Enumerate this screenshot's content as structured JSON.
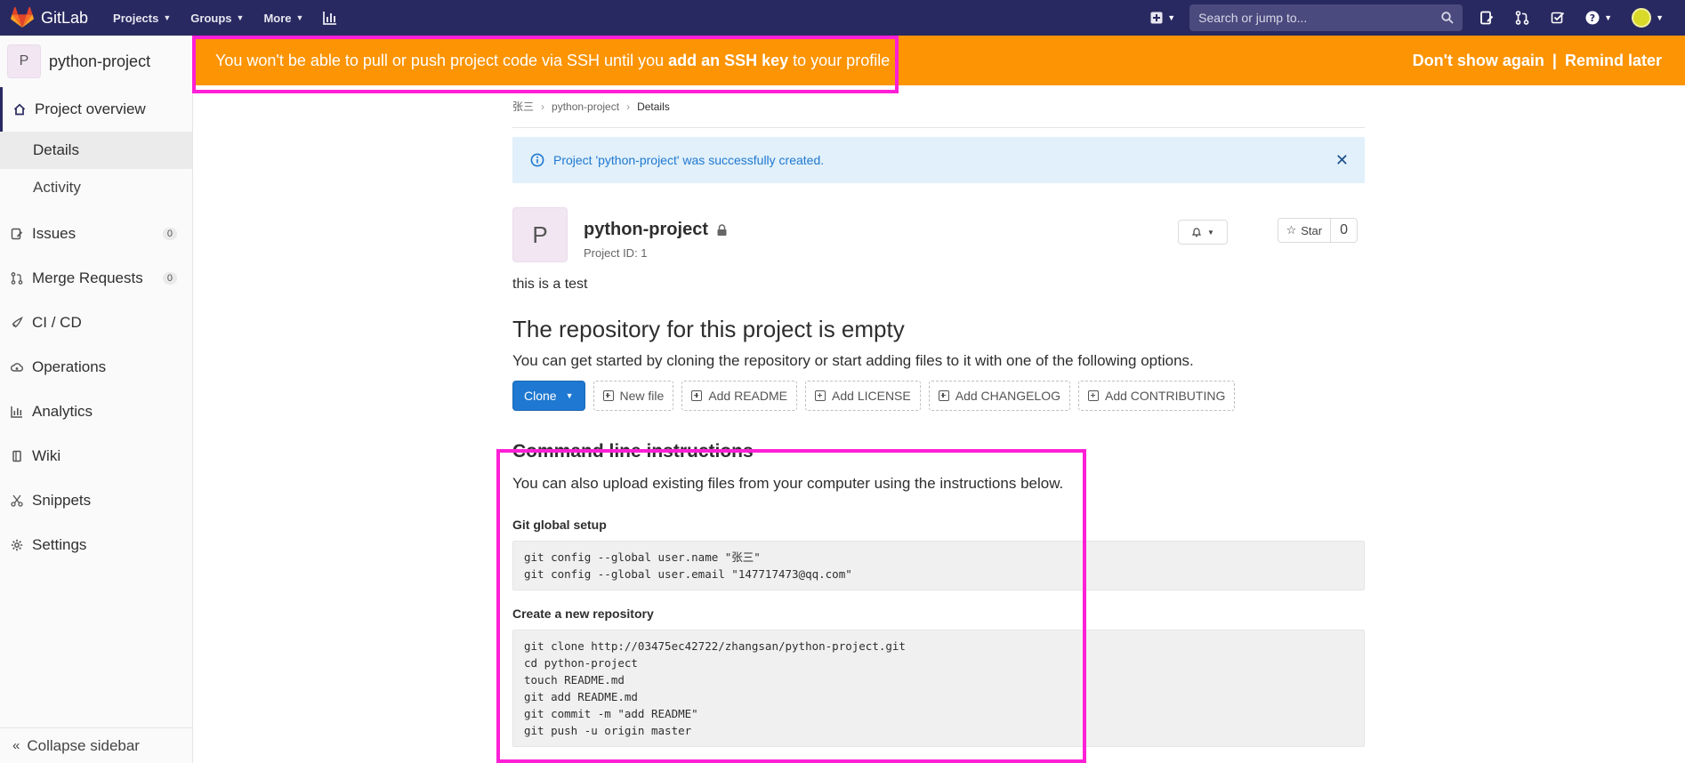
{
  "navbar": {
    "brand": "GitLab",
    "menu": [
      {
        "label": "Projects"
      },
      {
        "label": "Groups"
      },
      {
        "label": "More"
      }
    ],
    "search_placeholder": "Search or jump to..."
  },
  "sidebar": {
    "project_initial": "P",
    "project_name": "python-project",
    "overview_label": "Project overview",
    "sub_items": [
      "Details",
      "Activity"
    ],
    "items": [
      {
        "label": "Issues",
        "count": "0"
      },
      {
        "label": "Merge Requests",
        "count": "0"
      },
      {
        "label": "CI / CD"
      },
      {
        "label": "Operations"
      },
      {
        "label": "Analytics"
      },
      {
        "label": "Wiki"
      },
      {
        "label": "Snippets"
      },
      {
        "label": "Settings"
      }
    ],
    "collapse_label": "Collapse sidebar"
  },
  "ssh_banner": {
    "text_before": "You won't be able to pull or push project code via SSH until you ",
    "link_text": "add an SSH key",
    "text_after": " to your profile",
    "dont_show": "Don't show again",
    "separator": "|",
    "remind_later": "Remind later",
    "color": "#fc9403"
  },
  "breadcrumb": [
    "张三",
    "python-project",
    "Details"
  ],
  "flash": {
    "message": "Project 'python-project' was successfully created."
  },
  "project": {
    "initial": "P",
    "name": "python-project",
    "id_label": "Project ID: 1",
    "star_label": "Star",
    "star_count": "0",
    "description": "this is a test"
  },
  "empty_repo": {
    "heading": "The repository for this project is empty",
    "subtext": "You can get started by cloning the repository or start adding files to it with one of the following options.",
    "clone_label": "Clone",
    "buttons": [
      "New file",
      "Add README",
      "Add LICENSE",
      "Add CHANGELOG",
      "Add CONTRIBUTING"
    ]
  },
  "cli": {
    "heading": "Command line instructions",
    "subtext": "You can also upload existing files from your computer using the instructions below.",
    "global_setup_heading": "Git global setup",
    "global_setup_code": "git config --global user.name \"张三\"\ngit config --global user.email \"147717473@qq.com\"",
    "new_repo_heading": "Create a new repository",
    "new_repo_code": "git clone http://03475ec42722/zhangsan/python-project.git\ncd python-project\ntouch README.md\ngit add README.md\ngit commit -m \"add README\"\ngit push -u origin master"
  },
  "colors": {
    "navbar": "#292961",
    "accent": "#1f78d1",
    "highlight": "#ff1fd6"
  }
}
